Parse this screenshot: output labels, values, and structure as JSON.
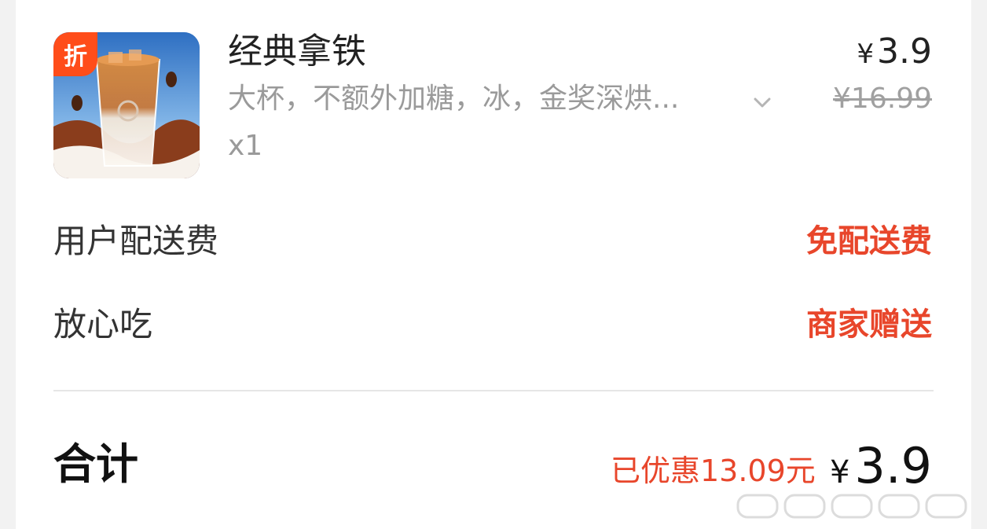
{
  "product": {
    "name": "经典拿铁",
    "specs": "大杯，不额外加糖，冰，金奖深烘...",
    "quantity": "x1",
    "badge": "折",
    "image_icon": "iced-latte-image",
    "price_currency": "¥",
    "price_now": "3.9",
    "price_original": "¥16.99"
  },
  "fees": [
    {
      "label": "用户配送费",
      "value": "免配送费"
    },
    {
      "label": "放心吃",
      "value": "商家赠送"
    }
  ],
  "total": {
    "label": "合计",
    "saved": "已优惠13.09元",
    "currency": "¥",
    "amount": "3.9"
  },
  "colors": {
    "accent": "#e8462b",
    "badge": "#ff4d1a",
    "text_primary": "#222222",
    "text_secondary": "#9a9a9a"
  }
}
